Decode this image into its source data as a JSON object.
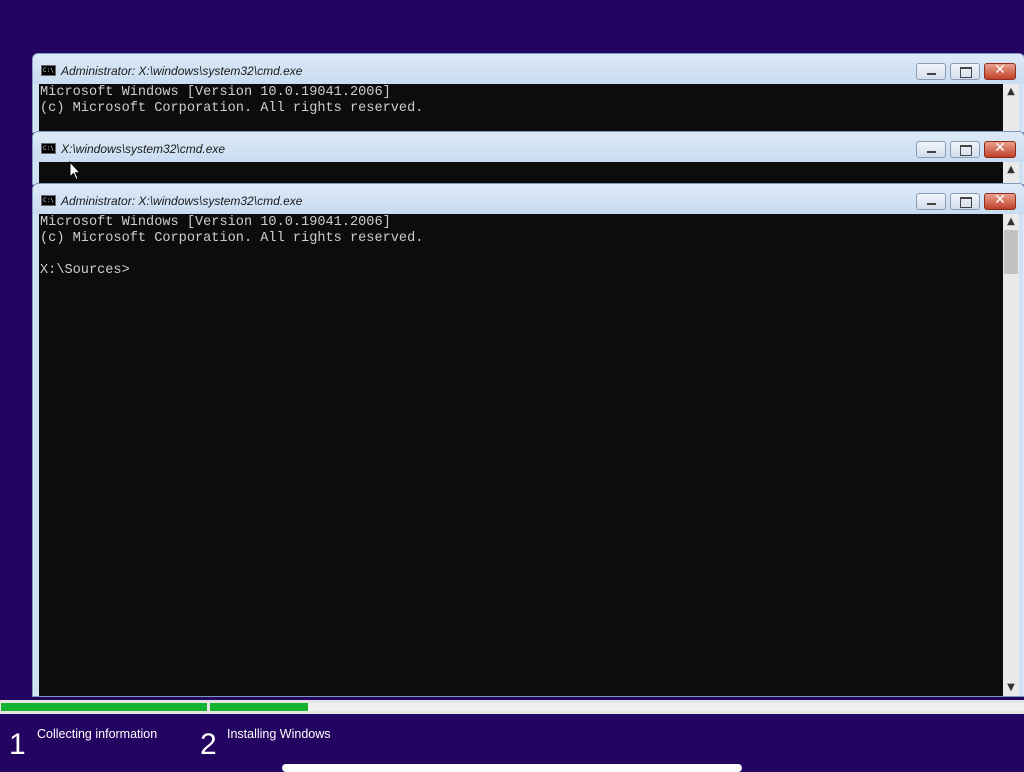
{
  "windows": [
    {
      "title": "Administrator: X:\\windows\\system32\\cmd.exe",
      "lines": [
        "Microsoft Windows [Version 10.0.19041.2006]",
        "(c) Microsoft Corporation. All rights reserved."
      ]
    },
    {
      "title": "X:\\windows\\system32\\cmd.exe",
      "lines": []
    },
    {
      "title": "Administrator: X:\\windows\\system32\\cmd.exe",
      "lines": [
        "Microsoft Windows [Version 10.0.19041.2006]",
        "(c) Microsoft Corporation. All rights reserved.",
        "",
        "X:\\Sources>"
      ]
    }
  ],
  "icons": {
    "console_app": "cmd-icon",
    "minimize": "minimize-icon",
    "maximize": "maximize-icon",
    "close": "close-icon",
    "scroll_up": "scroll-up-arrow-icon",
    "scroll_down": "scroll-down-arrow-icon",
    "cursor": "mouse-pointer-icon"
  },
  "setup": {
    "steps": [
      {
        "number": "1",
        "label": "Collecting information",
        "progress": 1.0
      },
      {
        "number": "2",
        "label": "Installing Windows",
        "progress": 0.12
      }
    ]
  },
  "colors": {
    "desktop": "#230461",
    "console_bg": "#0c0c0c",
    "console_text": "#cccccc",
    "progress": "#14b22e",
    "close_button": "#c0402a"
  }
}
